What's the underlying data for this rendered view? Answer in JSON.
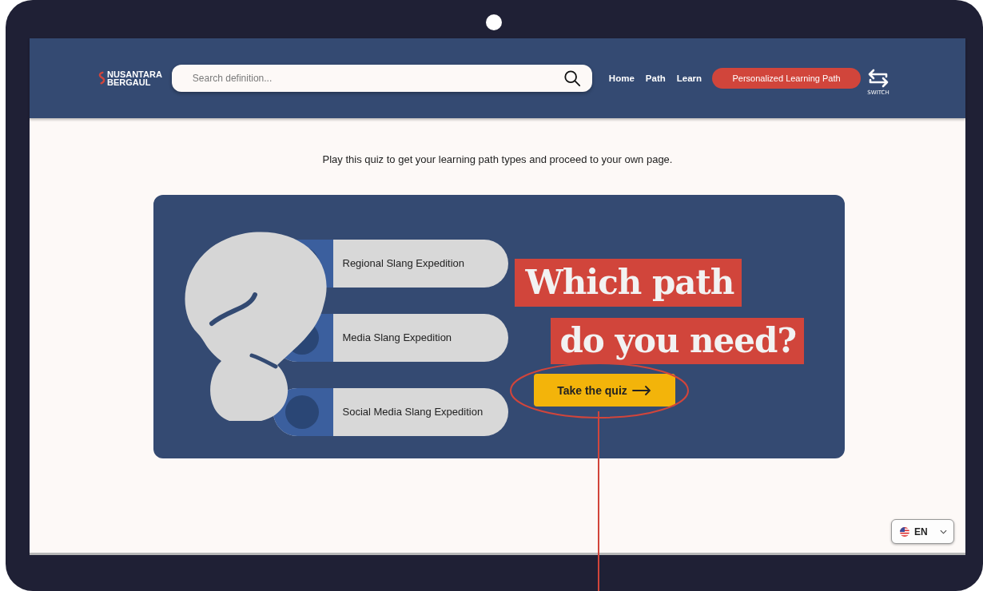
{
  "header": {
    "logo": [
      "NUSANTARA",
      "BERGAUL"
    ],
    "search": {
      "placeholder": "Search definition..."
    },
    "nav": [
      {
        "label": "Home",
        "selected": false
      },
      {
        "label": "Path",
        "selected": false
      },
      {
        "label": "Learn",
        "selected": false
      }
    ],
    "cta": "Personalized Learning Path",
    "switch_label": "SWITCH"
  },
  "intro": "Play this quiz to get your learning path types and proceed to your own page.",
  "paths": [
    {
      "label": "Regional Slang Expedition"
    },
    {
      "label": "Media Slang Expedition"
    },
    {
      "label": "Social Media Slang Expedition"
    }
  ],
  "headline": [
    "Which path",
    "do you need?"
  ],
  "quiz_button": "Take the quiz",
  "language": "EN"
}
